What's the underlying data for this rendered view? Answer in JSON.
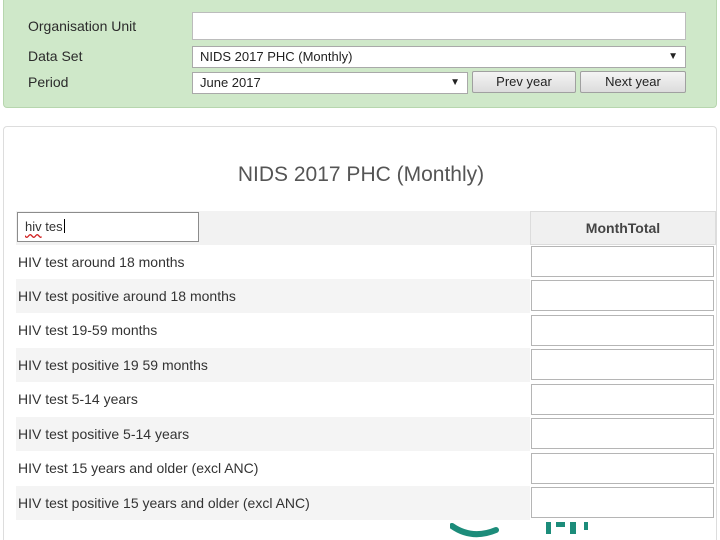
{
  "selection": {
    "org_unit_label": "Organisation Unit",
    "org_unit_value": "",
    "dataset_label": "Data Set",
    "dataset_value": "NIDS 2017 PHC (Monthly)",
    "period_label": "Period",
    "period_value": "June 2017",
    "prev_year_label": "Prev year",
    "next_year_label": "Next year"
  },
  "form": {
    "title": "NIDS 2017 PHC (Monthly)",
    "filter_value": "hiv tes",
    "filter_underlined": "hiv",
    "filter_rest": " tes",
    "column_header": "MonthTotal",
    "rows": [
      {
        "label": "HIV test around 18 months"
      },
      {
        "label": "HIV test positive around 18 months"
      },
      {
        "label": "HIV test 19-59 months"
      },
      {
        "label": "HIV test positive 19 59 months"
      },
      {
        "label": "HIV test 5-14 years"
      },
      {
        "label": "HIV test positive 5-14 years"
      },
      {
        "label": "HIV test 15 years and older (excl ANC)"
      },
      {
        "label": "HIV test positive 15 years and older (excl ANC)"
      }
    ]
  },
  "colors": {
    "selection_bg": "#cfe8c9",
    "logo_teal": "#1c8c7a"
  }
}
